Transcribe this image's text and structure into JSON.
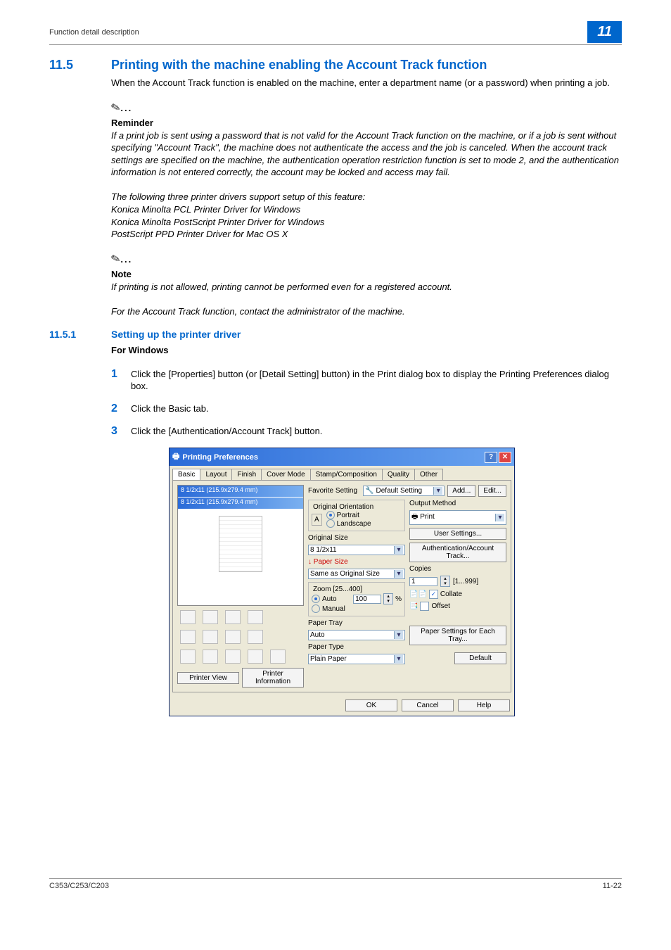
{
  "header": {
    "breadcrumb": "Function detail description",
    "chapter": "11"
  },
  "section": {
    "num": "11.5",
    "title": "Printing with the machine enabling the Account Track function",
    "intro": "When the Account Track function is enabled on the machine, enter a department name (or a password) when printing a job."
  },
  "reminder": {
    "heading": "Reminder",
    "p1": "If a print job is sent using a password that is not valid for the Account Track function on the machine, or if a job is sent without specifying \"Account Track\", the machine does not authenticate the access and the job is canceled. When the account track settings are specified on the machine, the authentication operation restriction function is set to mode 2, and the authentication information is not entered correctly, the account may be locked and access may fail.",
    "p2": "The following three printer drivers support setup of this feature:",
    "d1": "Konica Minolta PCL Printer Driver for Windows",
    "d2": "Konica Minolta PostScript Printer Driver for Windows",
    "d3": "PostScript PPD Printer Driver for Mac OS X"
  },
  "note": {
    "heading": "Note",
    "p1": "If printing is not allowed, printing cannot be performed even for a registered account.",
    "p2": "For the Account Track function, contact the administrator of the machine."
  },
  "subsection": {
    "num": "11.5.1",
    "title": "Setting up the printer driver",
    "sub": "For Windows"
  },
  "steps": {
    "s1": "Click the [Properties] button (or [Detail Setting] button) in the Print dialog box to display the Printing Preferences dialog box.",
    "s2": "Click the Basic tab.",
    "s3": "Click the [Authentication/Account Track] button."
  },
  "dialog": {
    "title": "Printing Preferences",
    "tabs": [
      "Basic",
      "Layout",
      "Finish",
      "Cover Mode",
      "Stamp/Composition",
      "Quality",
      "Other"
    ],
    "preview_line1": "8 1/2x11 (215.9x279.4 mm)",
    "preview_line2": "8 1/2x11 (215.9x279.4 mm)",
    "printer_view": "Printer View",
    "printer_info": "Printer Information",
    "fav_label": "Favorite Setting",
    "fav_value": "Default Setting",
    "add": "Add...",
    "edit": "Edit...",
    "orientation": {
      "title": "Original Orientation",
      "portrait": "Portrait",
      "landscape": "Landscape"
    },
    "original_size": {
      "label": "Original Size",
      "value": "8 1/2x11"
    },
    "paper_size": {
      "label": "Paper Size",
      "value": "Same as Original Size"
    },
    "zoom": {
      "title": "Zoom [25...400]",
      "auto": "Auto",
      "manual": "Manual",
      "value": "100",
      "pct": "%"
    },
    "paper_tray": {
      "label": "Paper Tray",
      "value": "Auto"
    },
    "paper_type": {
      "label": "Paper Type",
      "value": "Plain Paper"
    },
    "output_method": {
      "label": "Output Method",
      "value": "Print"
    },
    "user_settings": "User Settings...",
    "auth_btn": "Authentication/Account Track...",
    "copies": {
      "label": "Copies",
      "value": "1",
      "range": "[1...999]"
    },
    "collate": "Collate",
    "offset": "Offset",
    "paper_settings": "Paper Settings for Each Tray...",
    "default": "Default",
    "ok": "OK",
    "cancel": "Cancel",
    "help": "Help"
  },
  "footer": {
    "left": "C353/C253/C203",
    "right": "11-22"
  }
}
